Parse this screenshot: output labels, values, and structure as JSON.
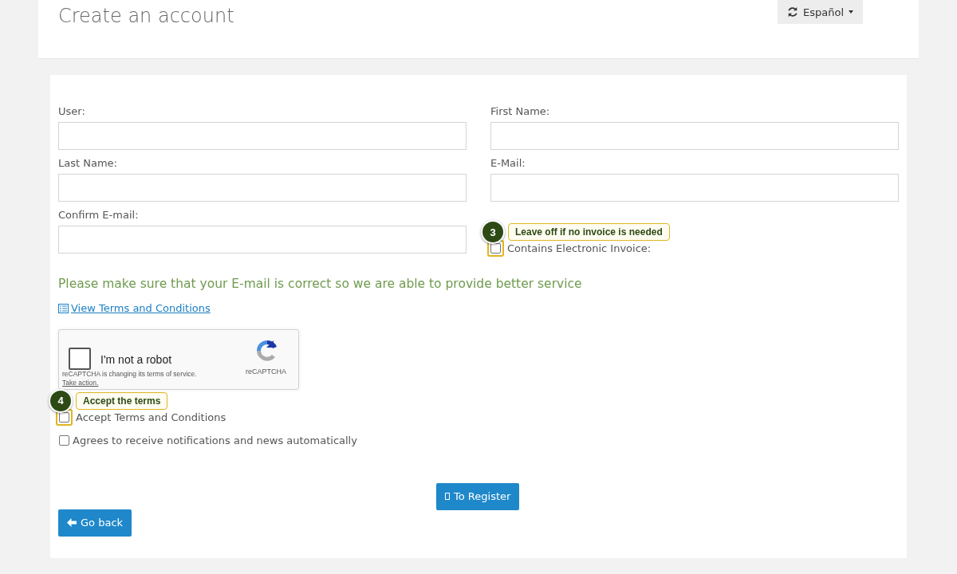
{
  "header": {
    "title": "Create an account",
    "language": {
      "label": "Español"
    }
  },
  "fields": [
    {
      "kind": "text",
      "label": "User:"
    },
    {
      "kind": "text",
      "label": "First Name:"
    },
    {
      "kind": "text",
      "label": "Last Name:"
    },
    {
      "kind": "text",
      "label": "E-Mail:"
    },
    {
      "kind": "text",
      "label": "Confirm E-mail:"
    },
    {
      "kind": "checkbox",
      "label": "Contains Electronic Invoice:",
      "checked": false,
      "highlighted": true,
      "callout": {
        "number": "3",
        "text": "Leave off if no invoice is needed"
      }
    }
  ],
  "notice": "Please make sure that your E-mail is correct so we are able to provide better service",
  "terms_link": "View Terms and Conditions",
  "captcha": {
    "label": "I'm not a robot",
    "checked": false,
    "brand": "reCAPTCHA",
    "notice": "reCAPTCHA is changing its terms of service.",
    "action": "Take action."
  },
  "checkboxes": [
    {
      "label": "Accept Terms and Conditions",
      "checked": false,
      "highlighted": true,
      "callout": {
        "number": "4",
        "text": "Accept the terms"
      }
    },
    {
      "label": "Agrees to receive notifications and news automatically",
      "checked": false,
      "highlighted": false
    }
  ],
  "register_button": "To Register",
  "back_button": "Go back"
}
